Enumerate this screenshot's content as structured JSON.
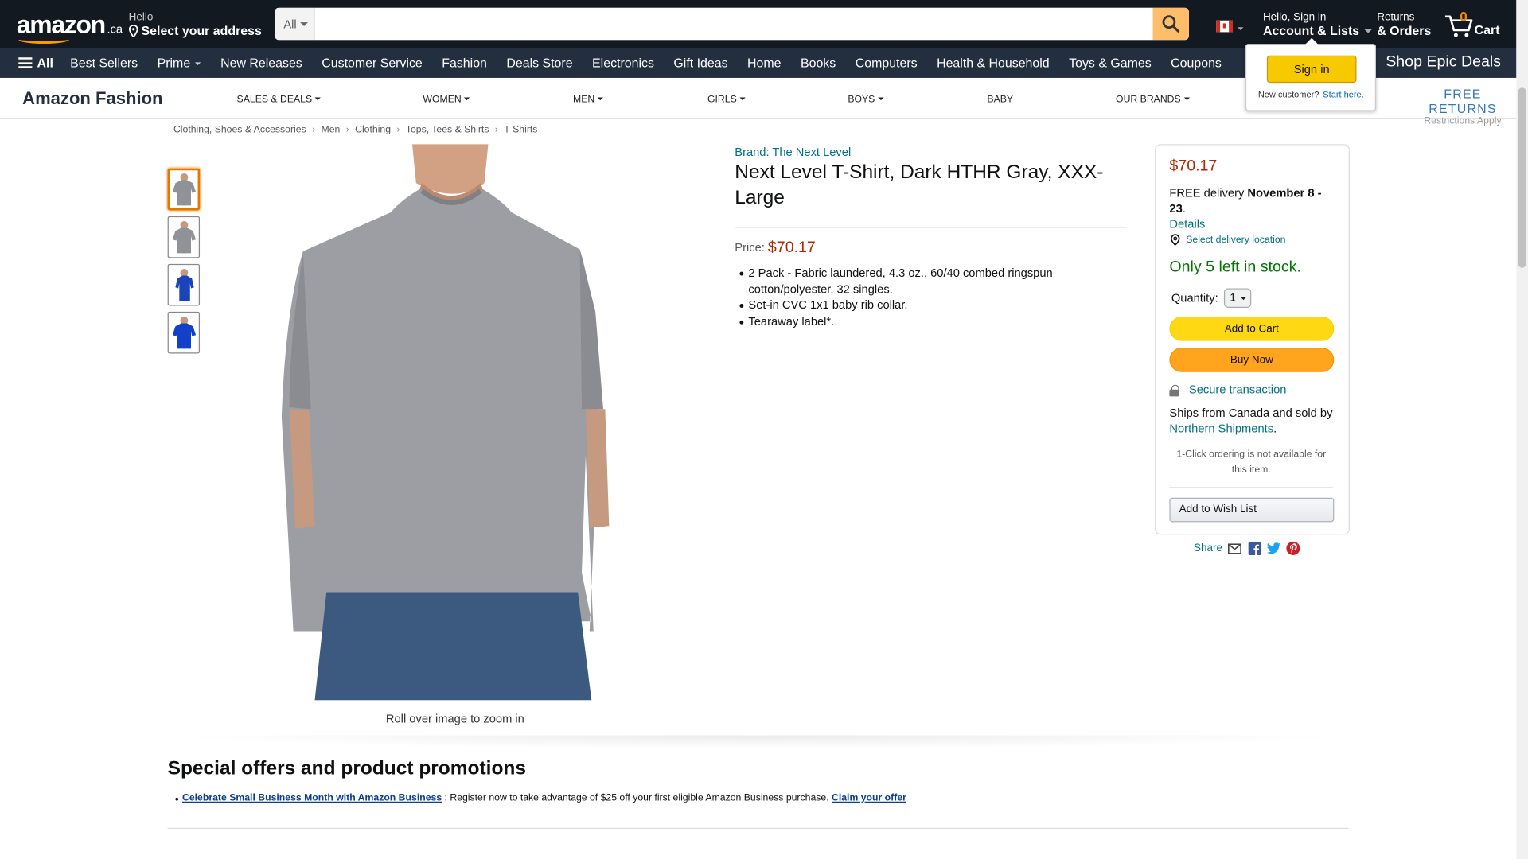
{
  "header": {
    "logo_text": "amazon",
    "logo_suffix": ".ca",
    "address_hello": "Hello",
    "address_label": "Select your address",
    "search_department": "All",
    "search_placeholder": "",
    "account_hello": "Hello, Sign in",
    "account_label": "Account & Lists",
    "returns_top": "Returns",
    "returns_bottom": "& Orders",
    "cart_count": "0",
    "cart_label": "Cart",
    "flag_country": "Canada"
  },
  "nav": {
    "all_label": "All",
    "links": [
      "Best Sellers",
      "Prime",
      "New Releases",
      "Customer Service",
      "Fashion",
      "Deals Store",
      "Electronics",
      "Gift Ideas",
      "Home",
      "Books",
      "Computers",
      "Health & Household",
      "Toys & Games",
      "Coupons"
    ],
    "promo": "Shop Epic Deals"
  },
  "signin_popover": {
    "button": "Sign in",
    "new_customer": "New customer?",
    "start_here": "Start here."
  },
  "fashion_bar": {
    "title": "Amazon Fashion",
    "categories": [
      "SALES & DEALS",
      "WOMEN",
      "MEN",
      "GIRLS",
      "BOYS",
      "BABY",
      "OUR BRANDS"
    ],
    "free_returns": "FREE RETURNS",
    "restrictions": "Restrictions Apply"
  },
  "breadcrumb": [
    "Clothing, Shoes & Accessories",
    "Men",
    "Clothing",
    "Tops, Tees & Shirts",
    "T-Shirts"
  ],
  "gallery": {
    "zoom_hint": "Roll over image to zoom in",
    "thumb_colors": [
      "#8f9297",
      "#8f9297",
      "#1a45b8",
      "#1240c9"
    ]
  },
  "product": {
    "brand": "Brand: The Next Level",
    "title": "Next Level T-Shirt, Dark HTHR Gray, XXX-Large",
    "price_label": "Price:",
    "price": "$70.17",
    "bullets": [
      "2 Pack - Fabric laundered, 4.3 oz., 60/40 combed ringspun cotton/polyester, 32 singles.",
      "Set-in CVC 1x1 baby rib collar.",
      "Tearaway label*."
    ]
  },
  "buybox": {
    "price": "$70.17",
    "delivery_prefix": "FREE delivery ",
    "delivery_dates": "November 8 - 23",
    "delivery_suffix": ".",
    "details": "Details",
    "location": "Select delivery location",
    "stock": "Only 5 left in stock.",
    "quantity_label": "Quantity:",
    "quantity_value": "1",
    "add_to_cart": "Add to Cart",
    "buy_now": "Buy Now",
    "secure": "Secure transaction",
    "ships_text": "Ships from Canada and sold by",
    "seller": "Northern Shipments",
    "seller_suffix": ".",
    "one_click": "1-Click ordering is not available for this item.",
    "wish_list": "Add to Wish List"
  },
  "share": {
    "label": "Share",
    "icons": [
      "email-icon",
      "facebook-icon",
      "twitter-icon",
      "pinterest-icon"
    ]
  },
  "offers": {
    "heading": "Special offers and product promotions",
    "link": "Celebrate Small Business Month with Amazon Business",
    "text": " : Register now to take advantage of $25 off your first eligible Amazon Business purchase. ",
    "claim": "Claim your offer"
  },
  "colors": {
    "nav_dark": "#131921",
    "nav_secondary": "#232f3e",
    "price_red": "#b12704",
    "stock_green": "#007600",
    "link_teal": "#007185",
    "add_to_cart_yellow": "#ffd814",
    "buy_now_orange": "#ffa41c"
  }
}
